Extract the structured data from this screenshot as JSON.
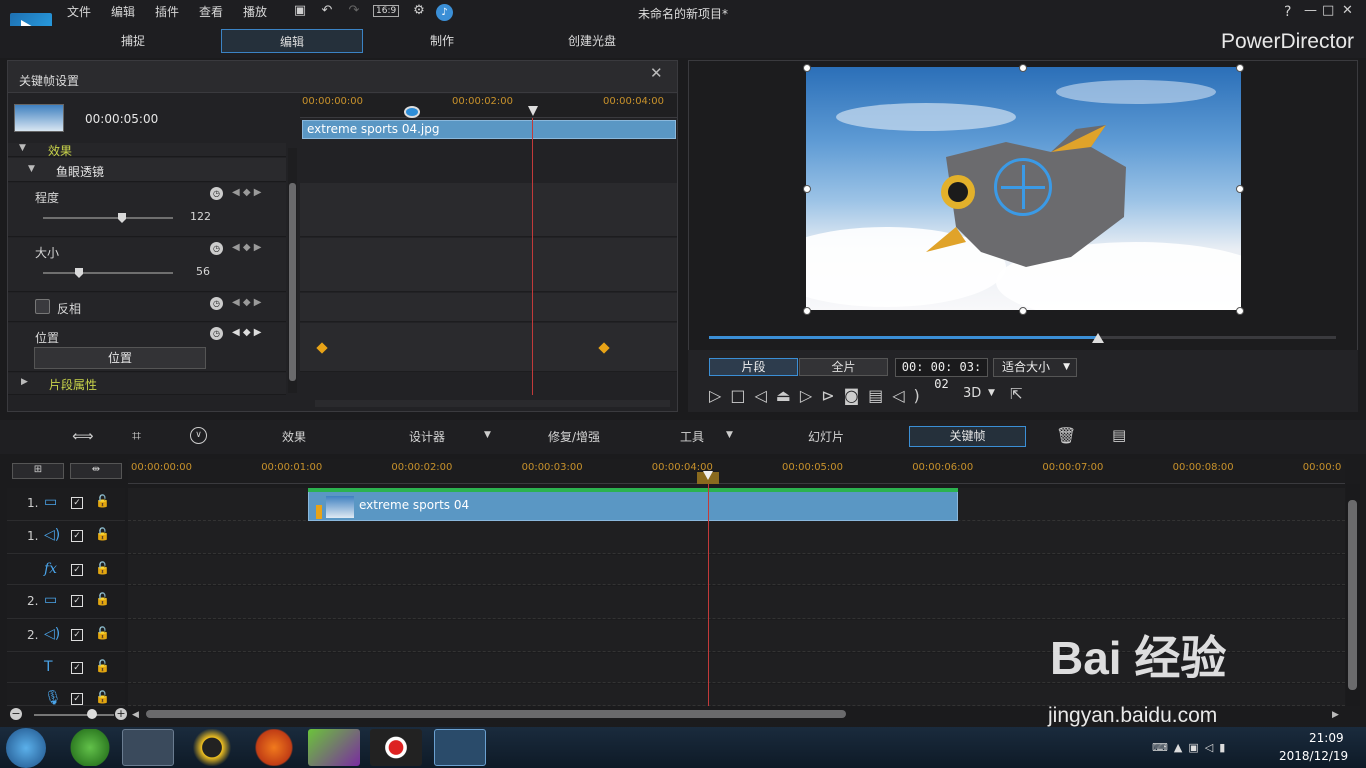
{
  "app": {
    "menus": [
      "文件",
      "编辑",
      "插件",
      "查看",
      "播放"
    ],
    "aspect": "16:9",
    "title": "未命名的新项目*",
    "window_controls": [
      "?",
      "—",
      "□",
      "✕"
    ],
    "brand": "PowerDirector"
  },
  "modes": [
    {
      "label": "捕捉",
      "active": false
    },
    {
      "label": "编辑",
      "active": true
    },
    {
      "label": "制作",
      "active": false
    },
    {
      "label": "创建光盘",
      "active": false
    }
  ],
  "keyframe_panel": {
    "title": "关键帧设置",
    "close": "✕",
    "clip_duration": "00:00:05:00",
    "ruler": [
      "00:00:00:00",
      "00:00:02:00",
      "00:00:04:00"
    ],
    "clip_name": "extreme sports 04.jpg",
    "section_effect": "效果",
    "effect_name": "鱼眼透镜",
    "params": [
      {
        "label": "程度",
        "value": "122",
        "level": 0.62
      },
      {
        "label": "大小",
        "value": "56",
        "level": 0.28
      }
    ],
    "invert_label": "反相",
    "position_label": "位置",
    "position_button": "位置",
    "clip_props": "片段属性"
  },
  "preview": {
    "seg_tab": "片段",
    "full_tab": "全片",
    "timecode": "00: 00: 03: 02",
    "fit": "适合大小",
    "mode_3d": "3D",
    "progress": 0.62
  },
  "edit_toolbar": {
    "effect": "效果",
    "designer": "设计器",
    "fix": "修复/增强",
    "tools": "工具",
    "slideshow": "幻灯片",
    "keyframe": "关键帧"
  },
  "timeline": {
    "ruler": [
      "00:00:00:00",
      "00:00:01:00",
      "00:00:02:00",
      "00:00:03:00",
      "00:00:04:00",
      "00:00:05:00",
      "00:00:06:00",
      "00:00:07:00",
      "00:00:08:00",
      "00:00:0"
    ],
    "tracks": [
      {
        "num": "1.",
        "type": "video"
      },
      {
        "num": "1.",
        "type": "audio"
      },
      {
        "num": "",
        "type": "fx"
      },
      {
        "num": "2.",
        "type": "video"
      },
      {
        "num": "2.",
        "type": "audio"
      },
      {
        "num": "",
        "type": "title"
      },
      {
        "num": "",
        "type": "voice"
      }
    ],
    "clip_name": "extreme sports 04"
  },
  "taskbar": {
    "time": "21:09",
    "date": "2018/12/19"
  },
  "watermark": {
    "brand": "Bai 经验",
    "url": "jingyan.baidu.com"
  },
  "colors": {
    "accent": "#3b8fd6",
    "keyframe": "#e8a317",
    "playhead": "#c23a3a",
    "clip": "#5a97c4"
  }
}
